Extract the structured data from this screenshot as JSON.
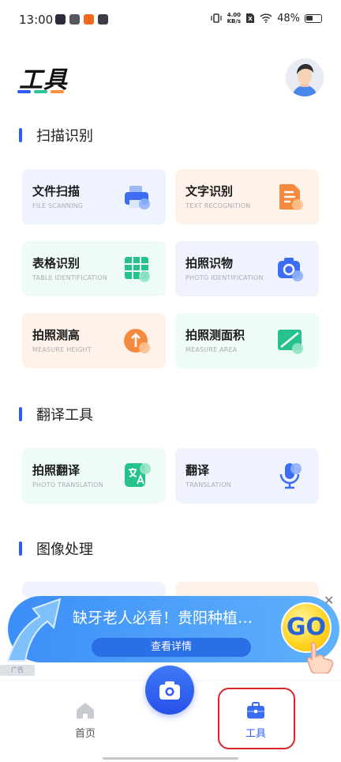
{
  "status_bar": {
    "time": "13:00",
    "speed_value": "4.00",
    "speed_unit": "KB/s",
    "battery": "48%"
  },
  "header": {
    "title": "工具",
    "title_bar_colors": [
      "#2f5bff",
      "#2bc59a",
      "#f5933d"
    ]
  },
  "sections": [
    {
      "title": "扫描识别"
    },
    {
      "title": "翻译工具"
    },
    {
      "title": "图像处理"
    }
  ],
  "cards": [
    {
      "name": "文件扫描",
      "sub": "FILE SCANNING",
      "icon": "printer-icon",
      "bg": "#eef3fd",
      "accent": "#3d6df2"
    },
    {
      "name": "文字识别",
      "sub": "TEXT RECOGNITION",
      "icon": "document-icon",
      "bg": "#fff2ea",
      "accent": "#f5893d"
    },
    {
      "name": "表格识别",
      "sub": "TABLE IDENTIFICATION",
      "icon": "table-icon",
      "bg": "#eefbf6",
      "accent": "#25c28b"
    },
    {
      "name": "拍照识物",
      "sub": "PHOTO IDENTIFICATION",
      "icon": "camera-search-icon",
      "bg": "#eef3fd",
      "accent": "#3d6df2"
    },
    {
      "name": "拍照测高",
      "sub": "MEASURE HEIGHT",
      "icon": "height-arrow-icon",
      "bg": "#fff2ea",
      "accent": "#f5893d"
    },
    {
      "name": "拍照测面积",
      "sub": "MEASURE AREA",
      "icon": "area-icon",
      "bg": "#eefbf6",
      "accent": "#25c28b"
    },
    {
      "name": "拍照翻译",
      "sub": "PHOTO TRANSLATION",
      "icon": "translate-icon",
      "bg": "#eefbf6",
      "accent": "#25c28b"
    },
    {
      "name": "翻译",
      "sub": "TRANSLATION",
      "icon": "microphone-icon",
      "bg": "#eef3fd",
      "accent": "#3d6df2"
    }
  ],
  "ad": {
    "headline": "缺牙老人必看！贵阳种植…",
    "button": "查看详情",
    "go": "GO",
    "tag": "广告"
  },
  "nav": {
    "home": "首页",
    "tools": "工具"
  },
  "colors": {
    "accent": "#2f5bff",
    "highlight": "#d9242a"
  }
}
